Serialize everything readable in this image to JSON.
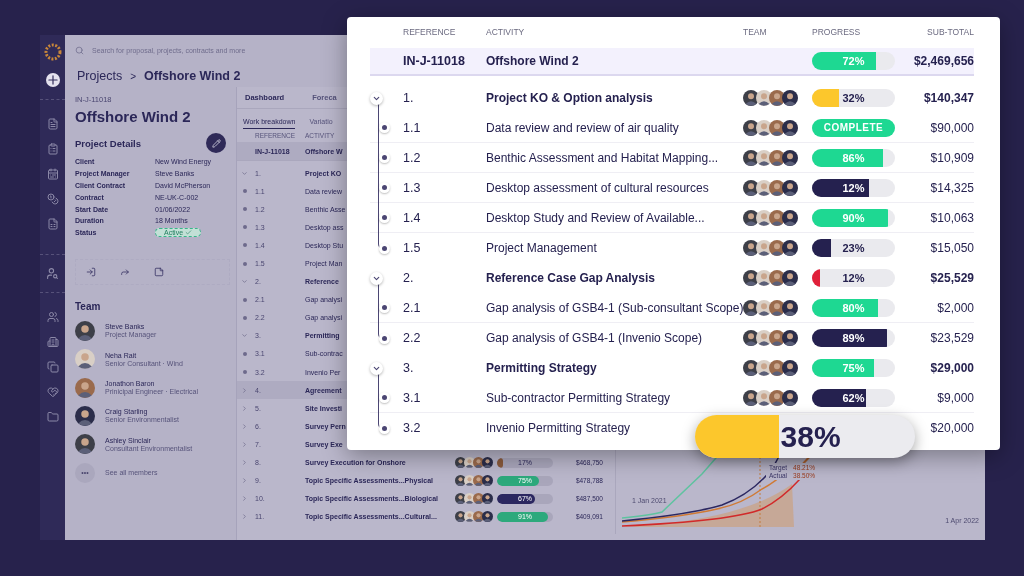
{
  "search": {
    "placeholder": "Search for proposal, projects, contracts and more"
  },
  "breadcrumb": {
    "parent": "Projects",
    "separator": ">",
    "current": "Offshore Wind 2"
  },
  "project": {
    "reference": "IN-J-11018",
    "title": "Offshore Wind 2",
    "details_title": "Project Details",
    "details": [
      {
        "label": "Client",
        "value": "New Wind Energy"
      },
      {
        "label": "Project Manager",
        "value": "Steve Banks"
      },
      {
        "label": "Client Contract",
        "value": "David McPherson"
      },
      {
        "label": "Contract",
        "value": "NE-UK-C-002"
      },
      {
        "label": "Start Date",
        "value": "01/06/2022"
      },
      {
        "label": "Duration",
        "value": "18 Months"
      }
    ],
    "status": {
      "label": "Status",
      "value": "Active"
    }
  },
  "team": {
    "title": "Team",
    "members": [
      {
        "name": "Steve Banks",
        "role": "Project Manager"
      },
      {
        "name": "Neha Rait",
        "role": "Senior Consultant · Wind"
      },
      {
        "name": "Jonathon Baron",
        "role": "Prinicipal Engineer · Electrical"
      },
      {
        "name": "Craig Starling",
        "role": "Senior Environmentalist"
      },
      {
        "name": "Ashley Sinclair",
        "role": "Consultant Environmentalist"
      }
    ],
    "more": {
      "icon": "•••",
      "label": "See all members"
    }
  },
  "main": {
    "tabs": [
      {
        "label": "Dashboard",
        "selected": true
      },
      {
        "label": "Foreca",
        "selected": false
      }
    ],
    "subtabs": [
      {
        "label": "Work breakdown",
        "selected": true
      },
      {
        "label": "Variatio",
        "selected": false
      }
    ],
    "columns": [
      "REFERENCE",
      "ACTIVITY"
    ],
    "summary": {
      "reference": "IN-J-11018",
      "activity": "Offshore W"
    },
    "rows": [
      {
        "kind": "group",
        "reference": "1.",
        "activity": "Project KO",
        "expanded": true,
        "selected": false
      },
      {
        "kind": "child",
        "reference": "1.1",
        "activity": "Data review",
        "selected": false
      },
      {
        "kind": "child",
        "reference": "1.2",
        "activity": "Benthic Asse",
        "selected": false
      },
      {
        "kind": "child",
        "reference": "1.3",
        "activity": "Desktop ass",
        "selected": false
      },
      {
        "kind": "child",
        "reference": "1.4",
        "activity": "Desktop Stu",
        "selected": false
      },
      {
        "kind": "child",
        "reference": "1.5",
        "activity": "Project Man",
        "selected": false
      },
      {
        "kind": "group",
        "reference": "2.",
        "activity": "Reference",
        "expanded": true,
        "selected": false
      },
      {
        "kind": "child",
        "reference": "2.1",
        "activity": "Gap analysi",
        "selected": false
      },
      {
        "kind": "child",
        "reference": "2.2",
        "activity": "Gap analysi",
        "selected": false
      },
      {
        "kind": "group",
        "reference": "3.",
        "activity": "Permitting",
        "expanded": true,
        "selected": false
      },
      {
        "kind": "child",
        "reference": "3.1",
        "activity": "Sub-contrac",
        "selected": false
      },
      {
        "kind": "child",
        "reference": "3.2",
        "activity": "Invenio Per",
        "selected": false
      },
      {
        "kind": "group",
        "reference": "4.",
        "activity": "Agreement",
        "expanded": false,
        "selected": true
      },
      {
        "kind": "group",
        "reference": "5.",
        "activity": "Site Investi",
        "expanded": false,
        "selected": false
      },
      {
        "kind": "group",
        "reference": "6.",
        "activity": "Survey Pern",
        "expanded": false,
        "selected": false
      },
      {
        "kind": "group",
        "reference": "7.",
        "activity": "Survey Exe",
        "expanded": false,
        "selected": false
      },
      {
        "kind": "group",
        "reference": "8.",
        "activity": "Survey Execution for Onshore",
        "expanded": false,
        "selected": false,
        "has_team": true,
        "progress": {
          "text": "17%",
          "level": 0.1,
          "color": "#8a5a3c"
        },
        "subtotal": "$468,750"
      },
      {
        "kind": "group",
        "reference": "9.",
        "activity": "Topic Specific Assessments...Physical",
        "expanded": false,
        "selected": false,
        "has_team": true,
        "progress": {
          "text": "75%",
          "level": 0.75,
          "color": "#2da97c"
        },
        "subtotal": "$478,788"
      },
      {
        "kind": "group",
        "reference": "10.",
        "activity": "Topic Specific Assessments...Biological",
        "expanded": false,
        "selected": false,
        "has_team": true,
        "progress": {
          "text": "67%",
          "level": 0.67,
          "color": "#2b2760"
        },
        "subtotal": "$487,500"
      },
      {
        "kind": "group",
        "reference": "11.",
        "activity": "Topic Specific Assessments...Cultural...",
        "expanded": false,
        "selected": false,
        "has_team": true,
        "progress": {
          "text": "91%",
          "level": 0.91,
          "color": "#2da97c"
        },
        "subtotal": "$409,091"
      }
    ],
    "chart": {
      "start_label": "1 Jan 2021",
      "end_label": "1 Apr 2022",
      "tooltip": [
        {
          "label": "Target",
          "value": "48.21%"
        },
        {
          "label": "Actual",
          "value": "38.50%"
        }
      ]
    }
  },
  "overlay": {
    "columns": [
      "REFERENCE",
      "ACTIVITY",
      "TEAM",
      "PROGRESS",
      "SUB-TOTAL"
    ],
    "summary": {
      "reference": "IN-J-11018",
      "activity": "Offshore Wind 2",
      "progress": {
        "kind": "bar",
        "text": "72%",
        "level": 0.77,
        "color": "#1ed892"
      },
      "subtotal": "$2,469,656"
    },
    "groups": [
      {
        "reference": "1.",
        "activity": "Project KO & Option analysis",
        "expanded": true,
        "has_team": true,
        "progress": {
          "kind": "bar",
          "text": "32%",
          "level": 0.33,
          "color": "#fcc72c"
        },
        "subtotal": "$140,347",
        "children": [
          {
            "reference": "1.1",
            "activity": "Data review and review of air quality",
            "has_team": true,
            "progress": {
              "kind": "pill",
              "text": "COMPLETE",
              "color": "#1ed892"
            },
            "subtotal": "$90,000"
          },
          {
            "reference": "1.2",
            "activity": "Benthic Assessment and Habitat Mapping...",
            "has_team": true,
            "progress": {
              "kind": "bar",
              "text": "86%",
              "level": 0.86,
              "color": "#1ed892"
            },
            "subtotal": "$10,909"
          },
          {
            "reference": "1.3",
            "activity": "Desktop assessment of cultural resources",
            "has_team": true,
            "progress": {
              "kind": "bar",
              "text": "12%",
              "level": 0.69,
              "color": "#25214f"
            },
            "subtotal": "$14,325"
          },
          {
            "reference": "1.4",
            "activity": "Desktop Study and Review of Available...",
            "has_team": true,
            "progress": {
              "kind": "bar",
              "text": "90%",
              "level": 0.91,
              "color": "#1ed892"
            },
            "subtotal": "$10,063"
          },
          {
            "reference": "1.5",
            "activity": "Project Management",
            "has_team": true,
            "progress": {
              "kind": "bar",
              "text": "23%",
              "level": 0.23,
              "color": "#25214f"
            },
            "subtotal": "$15,050"
          }
        ]
      },
      {
        "reference": "2.",
        "activity": "Reference Case Gap Analysis",
        "expanded": true,
        "has_team": true,
        "progress": {
          "kind": "bar",
          "text": "12%",
          "level": 0.1,
          "color": "#e0203a"
        },
        "subtotal": "$25,529",
        "children": [
          {
            "reference": "2.1",
            "activity": "Gap analysis of GSB4-1 (Sub-consultant Scope)",
            "has_team": true,
            "progress": {
              "kind": "bar",
              "text": "80%",
              "level": 0.8,
              "color": "#1ed892"
            },
            "subtotal": "$2,000"
          },
          {
            "reference": "2.2",
            "activity": "Gap analysis of GSB4-1 (Invenio Scope)",
            "has_team": true,
            "progress": {
              "kind": "bar",
              "text": "89%",
              "level": 0.9,
              "color": "#25214f"
            },
            "subtotal": "$23,529"
          }
        ]
      },
      {
        "reference": "3.",
        "activity": "Permitting Strategy",
        "expanded": true,
        "has_team": true,
        "progress": {
          "kind": "bar",
          "text": "75%",
          "level": 0.75,
          "color": "#1ed892"
        },
        "subtotal": "$29,000",
        "children": [
          {
            "reference": "3.1",
            "activity": "Sub-contractor Permitting Strategy",
            "has_team": true,
            "progress": {
              "kind": "bar",
              "text": "62%",
              "level": 0.65,
              "color": "#25214f"
            },
            "subtotal": "$9,000"
          },
          {
            "reference": "3.2",
            "activity": "Invenio Permitting Strategy",
            "has_team": false,
            "subtotal": "$20,000"
          }
        ]
      }
    ]
  },
  "highlight": {
    "text": "38%",
    "level": 0.38,
    "color": "#fcc72c"
  }
}
